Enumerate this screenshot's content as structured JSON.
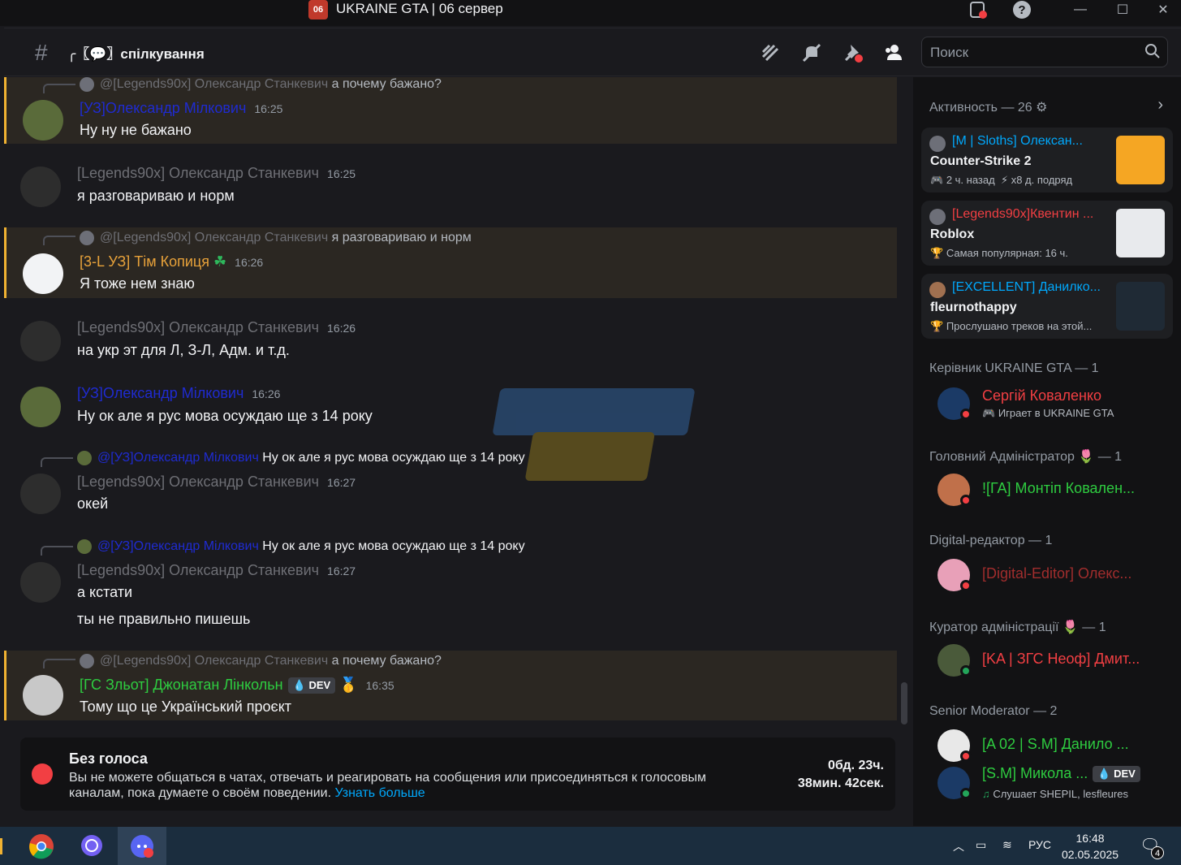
{
  "window": {
    "title": "UKRAINE GTA | 06 сервер",
    "app_icon": "06"
  },
  "header": {
    "channel_name": "╭〖💬〗спілкування",
    "search_placeholder": "Поиск"
  },
  "messages": [
    {
      "reply_to": "@[Legends90x] Олександр Станкевич",
      "reply_text": "а почему бажано?",
      "author": "[УЗ]Олександр Мілкович",
      "author_color": "#1f2bd1",
      "time": "16:25",
      "text": "Ну ну не бажано"
    },
    {
      "author": "[Legends90x] Олександр Станкевич",
      "author_color": "#6e6f75",
      "time": "16:25",
      "text": "я разговариваю и норм"
    },
    {
      "reply_to": "@[Legends90x] Олександр Станкевич",
      "reply_text": "я разговариваю и норм",
      "author": "[3-L УЗ] Тім Копиця",
      "author_color": "#e8a23a",
      "time": "16:26",
      "text": "Я тоже нем знаю"
    },
    {
      "author": "[Legends90x] Олександр Станкевич",
      "author_color": "#6e6f75",
      "time": "16:26",
      "text": "на укр эт для Л, З-Л, Адм. и т.д."
    },
    {
      "author": "[УЗ]Олександр Мілкович",
      "author_color": "#1f2bd1",
      "time": "16:26",
      "text": "Ну ок але я рус мова осуждаю ще з 14 року"
    },
    {
      "reply_to": "@[УЗ]Олександр Мілкович",
      "reply_text": "Ну ок але я рус мова осуждаю ще з 14 року",
      "author": "[Legends90x] Олександр Станкевич",
      "author_color": "#6e6f75",
      "time": "16:27",
      "text": "окей"
    },
    {
      "reply_to": "@[УЗ]Олександр Мілкович",
      "reply_text": "Ну ок але я рус мова осуждаю ще з 14 року",
      "author": "[Legends90x] Олександр Станкевич",
      "author_color": "#6e6f75",
      "time": "16:27",
      "text": "а кстати",
      "text2": "ты не правильно пишешь"
    },
    {
      "reply_to": "@[Legends90x] Олександр Станкевич",
      "reply_text": "а почему бажано?",
      "author": "[ГС Зльот] Джонатан Лінкольн",
      "author_color": "#2ecc40",
      "badge": "DEV",
      "time": "16:35",
      "text": "Тому що це Український проєкт"
    }
  ],
  "timeout": {
    "title": "Без голоса",
    "description": "Вы не можете общаться в чатах, отвечать и реагировать на сообщения или присоединяться к голосовым каналам, пока думаете о своём поведении.",
    "link": "Узнать больше",
    "timer_line1": "0бд. 23ч.",
    "timer_line2": "38мин. 42сек."
  },
  "activity": {
    "title": "Активность — 26",
    "cards": [
      {
        "name": "[M | Sloths] Олексан...",
        "game": "Counter-Strike 2",
        "meta1": "2 ч. назад",
        "meta2": "x8 д. подряд"
      },
      {
        "name": "[Legends90x]Квентин ...",
        "game": "Roblox",
        "meta1": "Самая популярная: 16 ч."
      },
      {
        "name": "[EXCELLENT] Данилко...",
        "game": "fleurnothappy",
        "meta1": "Прослушано треков на этой..."
      }
    ]
  },
  "roles": [
    {
      "header": "Керівник UKRAINE GTA — 1",
      "members": [
        {
          "name": "Сергій Коваленко",
          "color": "#f23f43",
          "sub": "Играет в UKRAINE GTA",
          "status": "dnd"
        }
      ]
    },
    {
      "header": "Головний Адміністратор 🌷 — 1",
      "members": [
        {
          "name": "![ГА] Монтіп Ковален...",
          "color": "#2ecc40",
          "status": "dnd"
        }
      ]
    },
    {
      "header": "Digital-редактор — 1",
      "members": [
        {
          "name": "[Digital-Editor] Олекс...",
          "color": "#a12d2d",
          "status": "dnd"
        }
      ]
    },
    {
      "header": "Куратор адміністрації 🌷 — 1",
      "members": [
        {
          "name": "[KA | ЗГС Неоф] Дмит...",
          "color": "#f23f43",
          "status": "online"
        }
      ]
    },
    {
      "header": "Senior Moderator — 2",
      "members": [
        {
          "name": "[A 02 | S.M] Данило ...",
          "color": "#2ecc40",
          "status": "dnd"
        },
        {
          "name": "[S.M] Микола ...",
          "color": "#2ecc40",
          "badge": "DEV",
          "sub": "Слушает SHEPIL, lesfleures",
          "status": "online"
        }
      ]
    }
  ],
  "taskbar": {
    "lang": "РУС",
    "time": "16:48",
    "date": "02.05.2025",
    "notif_count": "4"
  }
}
